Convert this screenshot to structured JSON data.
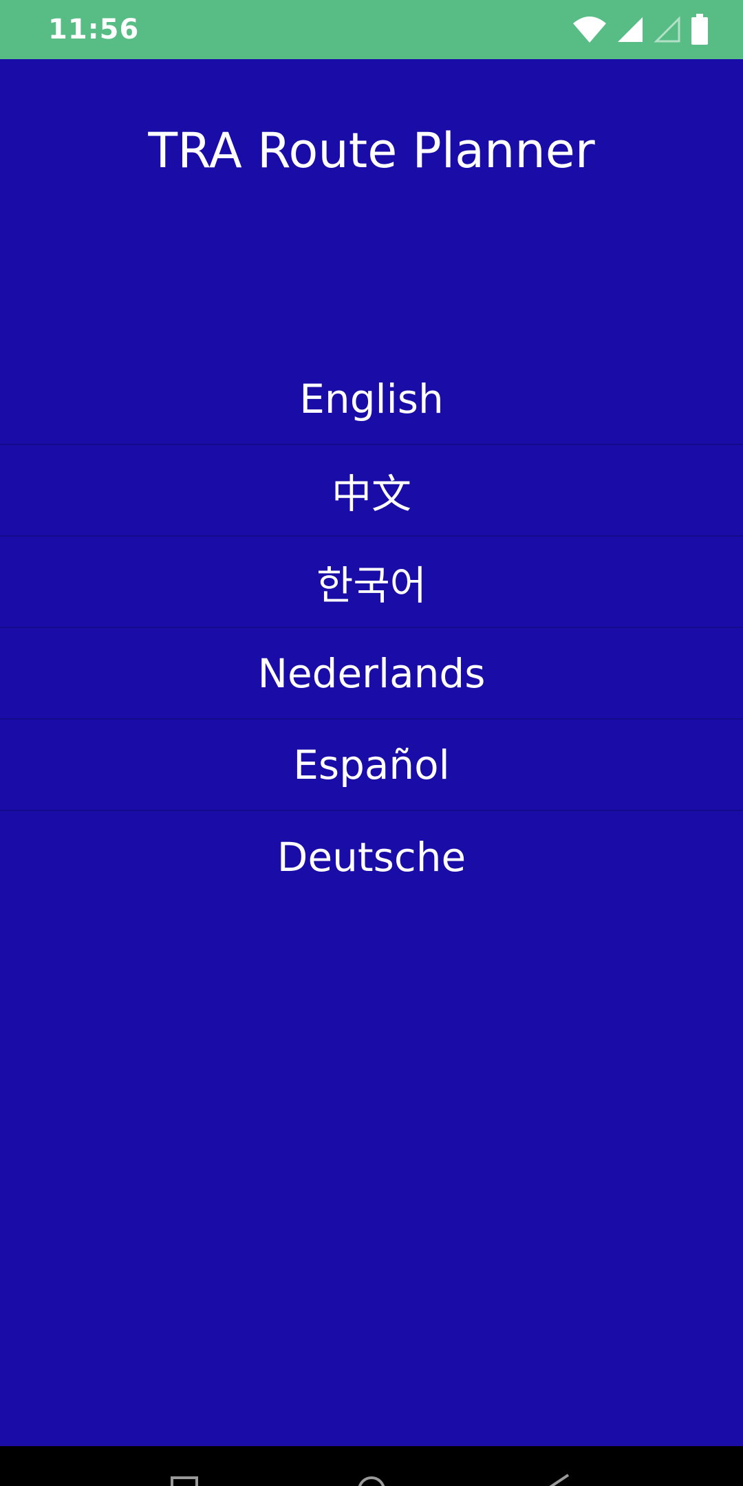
{
  "status_bar": {
    "time": "11:56",
    "icons": [
      "wifi-icon",
      "cellular-signal-icon",
      "cellular-signal-empty-icon",
      "battery-icon"
    ]
  },
  "app": {
    "title": "TRA Route Planner",
    "languages": [
      {
        "label": "English"
      },
      {
        "label": "中文"
      },
      {
        "label": "한국어"
      },
      {
        "label": "Nederlands"
      },
      {
        "label": "Español"
      },
      {
        "label": "Deutsche"
      }
    ]
  },
  "nav_bar": {
    "buttons": [
      "recents-icon",
      "home-icon",
      "back-icon"
    ]
  },
  "colors": {
    "status_bar": "#57bd84",
    "background": "#1a0ca6",
    "text": "#ffffff",
    "divider": "#160a8c"
  }
}
